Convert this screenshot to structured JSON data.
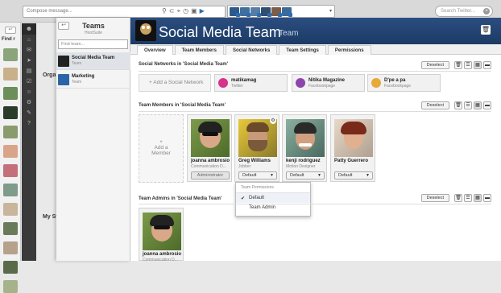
{
  "topbar": {
    "compose_placeholder": "Compose message...",
    "compose_icons": [
      "link-icon",
      "attachment-icon",
      "location-icon",
      "schedule-icon",
      "lock-icon",
      "send-icon"
    ],
    "search_placeholder": "Search Twitter...",
    "avatar_count": 6
  },
  "far_left": {
    "find_label": "Find r",
    "avatar_colors": [
      "#8ba57a",
      "#c7b08a",
      "#6b8e5a",
      "#2b3c2a",
      "#8a9c6e",
      "#d8a58a",
      "#c4707a",
      "#7f9b8a",
      "#c9b59c",
      "#6a7b5a",
      "#b5a28a",
      "#5b6b4a",
      "#a6b28a"
    ]
  },
  "side_nav": {
    "icons": [
      "home-icon",
      "messages-icon",
      "send-icon",
      "analytics-icon",
      "tasks-icon",
      "contacts-icon",
      "settings-icon",
      "tools-icon",
      "help-icon"
    ]
  },
  "stream_labels": [
    "Orga",
    "My St"
  ],
  "teams_panel": {
    "title": "Teams",
    "subtitle": "HootSuite",
    "find_placeholder": "Find team...",
    "items": [
      {
        "name": "Social Media Team",
        "sub": "Team",
        "selected": true
      },
      {
        "name": "Marketing",
        "sub": "Team",
        "selected": false
      }
    ]
  },
  "header": {
    "title": "Social Media Team",
    "type": "Team"
  },
  "tabs": [
    "Overview",
    "Team Members",
    "Social Networks",
    "Team Settings",
    "Permissions"
  ],
  "social_networks": {
    "title": "Social Networks in 'Social Media Team'",
    "deselect": "Deselect",
    "add_label": "Add a Social Network",
    "items": [
      {
        "name": "matikamag",
        "type": "Twitter",
        "color": "#d6338a"
      },
      {
        "name": "Nitika Magazine",
        "type": "Facebookpage",
        "color": "#8e44ad"
      },
      {
        "name": "D'pe a pa",
        "type": "Facebookpage",
        "color": "#e6a93a"
      }
    ]
  },
  "team_members": {
    "title": "Team Members in 'Social Media Team'",
    "deselect": "Deselect",
    "add_label_1": "Add a",
    "add_label_2": "Member",
    "members": [
      {
        "name": "joanna ambrosio",
        "role": "Communication D...",
        "button": "Administrator"
      },
      {
        "name": "Greg Williams",
        "role": "Jobber",
        "button": "Default"
      },
      {
        "name": "kenji rodriguez",
        "role": "Motion Designer",
        "button": "Default"
      },
      {
        "name": "Patty Guerrero",
        "role": "",
        "button": "Default"
      }
    ]
  },
  "permissions_menu": {
    "header": "Team Permissions",
    "options": [
      {
        "label": "Default",
        "checked": true
      },
      {
        "label": "Team Admin",
        "checked": false
      }
    ]
  },
  "team_admins": {
    "title": "Team Admins in 'Social Media Team'",
    "deselect": "Deselect",
    "admins": [
      {
        "name": "joanna ambrosio",
        "role": "Communication D..."
      }
    ]
  }
}
